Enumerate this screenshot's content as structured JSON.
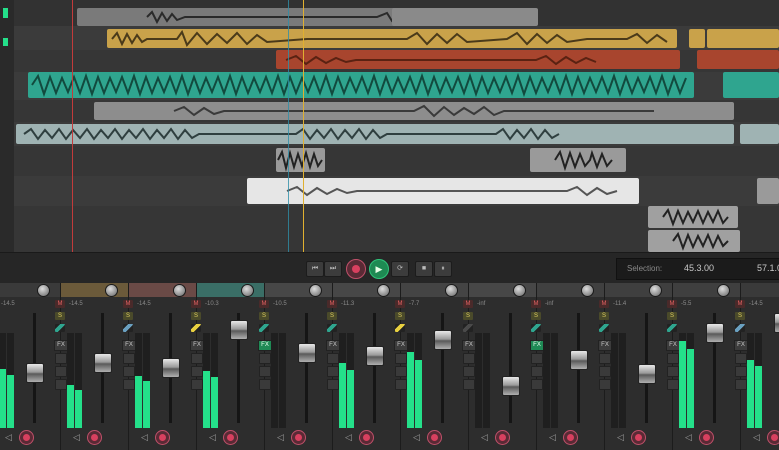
{
  "transport": {
    "buttons": [
      {
        "name": "go-to-start-button",
        "glyph": "⏮"
      },
      {
        "name": "go-to-end-button",
        "glyph": "⏭"
      },
      {
        "name": "record-button",
        "glyph": ""
      },
      {
        "name": "play-button",
        "glyph": "▶"
      },
      {
        "name": "loop-button",
        "glyph": "⟳"
      },
      {
        "name": "stop-button",
        "glyph": "■"
      },
      {
        "name": "pause-button",
        "glyph": "⏸"
      }
    ],
    "selection_label": "Selection:",
    "selection_start": "45.3.00",
    "selection_end": "57.1.0"
  },
  "colors": {
    "meter": "#24e08a",
    "record": "#d8405f",
    "play": "#1e8a53"
  },
  "mixer": {
    "fx_label": "FX",
    "mute_label": "M",
    "solo_label": "S",
    "channels": [
      {
        "db": "-14.5",
        "level": 0.62
      },
      {
        "db": "-14.5",
        "level": 0.45
      },
      {
        "db": "-14.5",
        "level": 0.55
      },
      {
        "db": "-10.3",
        "level": 0.6
      },
      {
        "db": "-10.5",
        "level": 0.0
      },
      {
        "db": "-11.3",
        "level": 0.68
      },
      {
        "db": "-7.7",
        "level": 0.8
      },
      {
        "db": "-inf",
        "level": 0.0
      },
      {
        "db": "-inf",
        "level": 0.0
      },
      {
        "db": "-11.4",
        "level": 0.0
      },
      {
        "db": "-5.5",
        "level": 0.92
      },
      {
        "db": "-14.5",
        "level": 0.72
      }
    ]
  }
}
